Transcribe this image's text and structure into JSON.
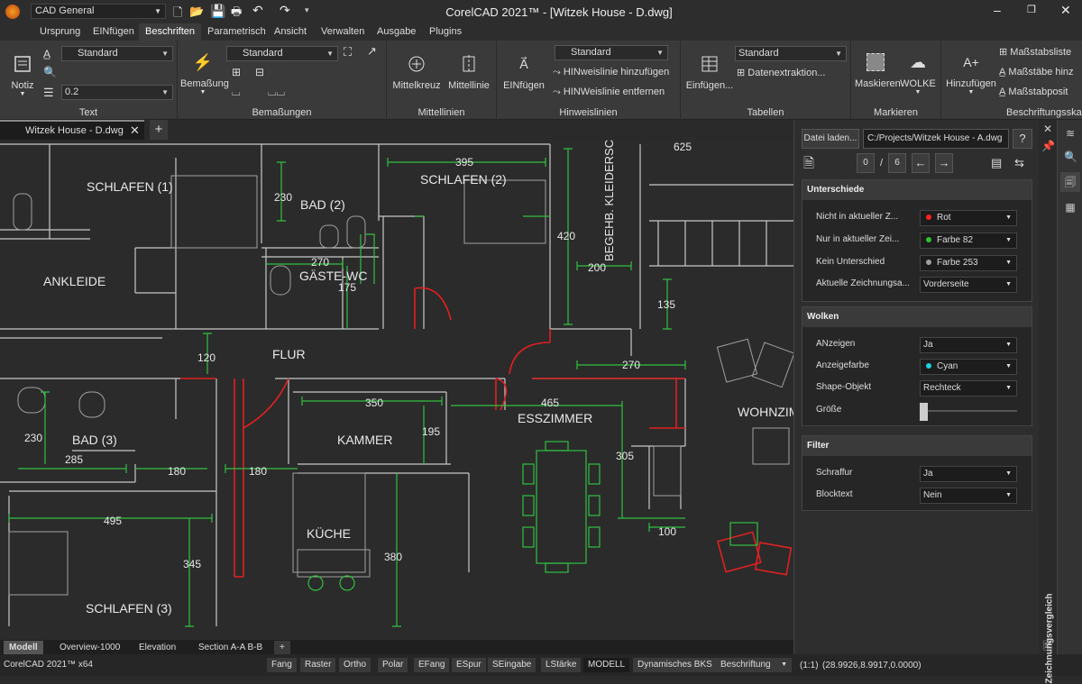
{
  "app": {
    "title": "CorelCAD 2021™ - [Witzek House - D.dwg]",
    "workspace": "CAD General",
    "version_label": "CorelCAD 2021™ x64",
    "window_controls": [
      "minimize-icon",
      "restore-icon",
      "close-icon"
    ]
  },
  "menu": {
    "items": [
      "Ursprung",
      "EINfügen",
      "Beschriften",
      "Parametrisch",
      "Ansicht",
      "Verwalten",
      "Ausgabe",
      "Plugins"
    ],
    "active": "Beschriften"
  },
  "ribbon": {
    "text": {
      "notiz": "Notiz",
      "style": "Standard",
      "height": "0.2",
      "label": "Text"
    },
    "bemassungen": {
      "btn": "Bemaßung",
      "style": "Standard",
      "label": "Bemaßungen"
    },
    "mittellinien": {
      "kreuz": "Mittelkreuz",
      "linie": "Mittellinie",
      "label": "Mittellinien"
    },
    "hinweislinien": {
      "einfuegen": "EINfügen",
      "style": "Standard",
      "add": "HINweislinie hinzufügen",
      "remove": "HINWeislinie entfernen",
      "label": "Hinweislinien"
    },
    "tabellen": {
      "einfuegen": "Einfügen...",
      "style": "Standard",
      "extract": "Datenextraktion...",
      "label": "Tabellen"
    },
    "markieren": {
      "maskieren": "Maskieren",
      "wolke": "WOLKE",
      "label": "Markieren"
    },
    "beschriftungsskala": {
      "hinzufuegen": "Hinzufügen",
      "list": "Maßstabsliste",
      "add_scale": "Maßstäbe hinz",
      "pos": "Maßstabposit",
      "label": "Beschriftungsska"
    }
  },
  "doc_tab": {
    "name": "Witzek House - D.dwg"
  },
  "drawing": {
    "rooms": [
      "SCHLAFEN (1)",
      "BAD (2)",
      "SCHLAFEN (2)",
      "ANKLEIDE",
      "GÄSTE-WC",
      "BEGEHB. KLEIDERSCHRANK",
      "FLUR",
      "BAD (3)",
      "KAMMER",
      "ESSZIMMER",
      "WOHNZIM",
      "KÜCHE",
      "SCHLAFEN (3)"
    ],
    "dims": [
      "625",
      "395",
      "230",
      "270",
      "175",
      "420",
      "200",
      "135",
      "120",
      "270",
      "350",
      "465",
      "195",
      "305",
      "230",
      "285",
      "180",
      "180",
      "495",
      "345",
      "380",
      "100"
    ]
  },
  "layout_tabs": [
    "Modell",
    "Overview-1000",
    "Elevation",
    "Section A-A B-B",
    "+"
  ],
  "status": {
    "buttons": [
      "Fang",
      "Raster",
      "Ortho",
      "Polar",
      "EFang",
      "ESpur",
      "SEingabe",
      "LStärke",
      "MODELL",
      "Dynamisches BKS"
    ],
    "annotation": "Beschriftung",
    "scale": "(1:1)",
    "coords": "(28.9926,8.9917,0.0000)"
  },
  "panel": {
    "load_btn": "Datei laden...",
    "path": "C:/Projects/Witzek House - A.dwg",
    "help": "?",
    "page_current": "0",
    "page_sep": "/",
    "page_total": "6",
    "unterschiede": {
      "title": "Unterschiede",
      "rows": [
        {
          "label": "Nicht in aktueller Z...",
          "value": "Rot",
          "color": "#ff2020"
        },
        {
          "label": "Nur in aktueller Zei...",
          "value": "Farbe 82",
          "color": "#30c030"
        },
        {
          "label": "Kein Unterschied",
          "value": "Farbe 253",
          "color": "#a0a0a0"
        },
        {
          "label": "Aktuelle Zeichnungsa...",
          "value": "Vorderseite"
        }
      ]
    },
    "wolken": {
      "title": "Wolken",
      "rows": [
        {
          "label": "ANzeigen",
          "value": "Ja"
        },
        {
          "label": "Anzeigefarbe",
          "value": "Cyan",
          "color": "#20d0e0"
        },
        {
          "label": "Shape-Objekt",
          "value": "Rechteck"
        },
        {
          "label": "Größe",
          "value": ""
        }
      ]
    },
    "filter": {
      "title": "Filter",
      "rows": [
        {
          "label": "Schraffur",
          "value": "Ja"
        },
        {
          "label": "Blocktext",
          "value": "Nein"
        }
      ]
    },
    "vertical_title": "Zeichnungsvergleich"
  }
}
